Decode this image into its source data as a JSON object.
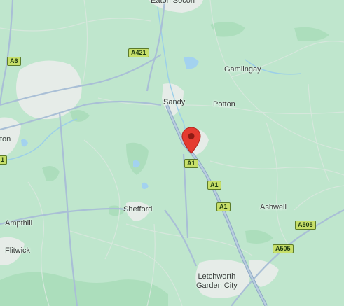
{
  "places": {
    "eaton_socon": "Eaton Socon",
    "gamlingay": "Gamlingay",
    "sandy": "Sandy",
    "potton": "Potton",
    "ton": "ton",
    "shefford": "Shefford",
    "ashwell": "Ashwell",
    "ampthill": "Ampthill",
    "flitwick": "Flitwick",
    "letchworth_line1": "Letchworth",
    "letchworth_line2": "Garden City"
  },
  "roads": {
    "a6": "A6",
    "a421": "A421",
    "a1_north": "A1",
    "a1_mid": "A1",
    "a1_south": "A1",
    "a505_west": "A505",
    "a505_east": "A505",
    "a1_edge": "1"
  },
  "marker": {
    "icon": "map-pin-icon",
    "color": "#e53b30"
  },
  "colors": {
    "land": "#bfe6cd",
    "urban": "#e9ece9",
    "major_road": "#a9bfd6",
    "water": "#a3d2ef"
  }
}
